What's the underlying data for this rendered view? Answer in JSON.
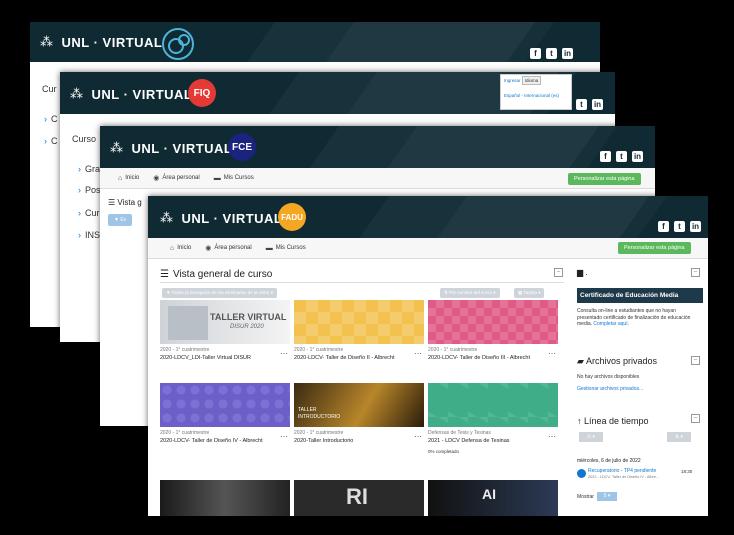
{
  "brand": "UNL · VIRTUAL",
  "social": [
    "f",
    "t",
    "in"
  ],
  "windows": {
    "w1": {
      "side": [
        "Cur",
        "C",
        "C"
      ]
    },
    "w2": {
      "badge": "FIQ",
      "dropdown": {
        "items": [
          "Español - Internacional (es)"
        ],
        "tooltip": "Idioma",
        "top": "Ingresar"
      },
      "side": [
        "Curso",
        "Gra",
        "Pos",
        "Cur",
        "INS"
      ]
    },
    "w3": {
      "badge": "FCE",
      "nav": [
        "Inicio",
        "Área personal",
        "Mis Cursos"
      ],
      "green": "Personalizar esta página",
      "vista_stub": "Vista g",
      "filter_stub": "Ex"
    },
    "w4": {
      "badge": "FADU",
      "nav": [
        "Inicio",
        "Área personal",
        "Mis Cursos"
      ],
      "green": "Personalizar esta página",
      "section_title": "Vista general de curso",
      "filter": "Todos (a excepción de los eliminados de la vista)",
      "sort": "Por nombre del curso",
      "view": "Tarjeta",
      "courses": [
        {
          "cat": "2020 - 1° cuatrimestre",
          "name": "2020-LDCV_LDI-Taller Virtual DISUR",
          "img_text": "TALLER VIRTUAL",
          "img_sub": "DISUR 2020"
        },
        {
          "cat": "2020 - 1° cuatrimestre",
          "name": "2020-LDCV- Taller de Diseño II - Albrecht"
        },
        {
          "cat": "2020 - 1° cuatrimestre",
          "name": "2020-LDCV- Taller de Diseño III - Albrecht"
        },
        {
          "cat": "2020 - 1° cuatrimestre",
          "name": "2020-LDCV- Taller de Diseño IV - Albrecht"
        },
        {
          "cat": "2020 - 1° cuatrimestre",
          "name": "2020-Taller Introductorio",
          "img_text": "TALLER",
          "img_sub": "INTRODUCTORIO"
        },
        {
          "cat": "Defensas de Tesis y Tesinas",
          "name": "2021 - LDCV Defensa de Tesinas",
          "progress": "0% completado"
        }
      ],
      "side_blocks": {
        "block1_title": ".",
        "cert_button": "Certificado de Educación Media",
        "cert_text": "Consulta on-line a estudiantes que no hayan presentado certificado de finalización de educación media.",
        "cert_link": "Completar aquí.",
        "private_title": "Archivos privados",
        "private_none": "No hay archivos disponibles",
        "private_link": "Gestionar archivos privados...",
        "timeline_title": "Línea de tiempo",
        "date": "miércoles, 6 de julio de 2022",
        "event_title": "Recuperatorio - TP4 pendiente",
        "event_sub": "2022 - LDCV- Taller de Diseño IV - Albre...",
        "event_time": "18:30",
        "show_label": "Mostrar",
        "show_value": "5"
      },
      "bottom_texts": [
        "RI",
        "AI"
      ]
    }
  },
  "colors": {
    "header": "#0f2a33",
    "fiq": "#e53935",
    "fce": "#1a237e",
    "fadu": "#f5a623",
    "green": "#5cb85c",
    "link": "#1177d1"
  }
}
